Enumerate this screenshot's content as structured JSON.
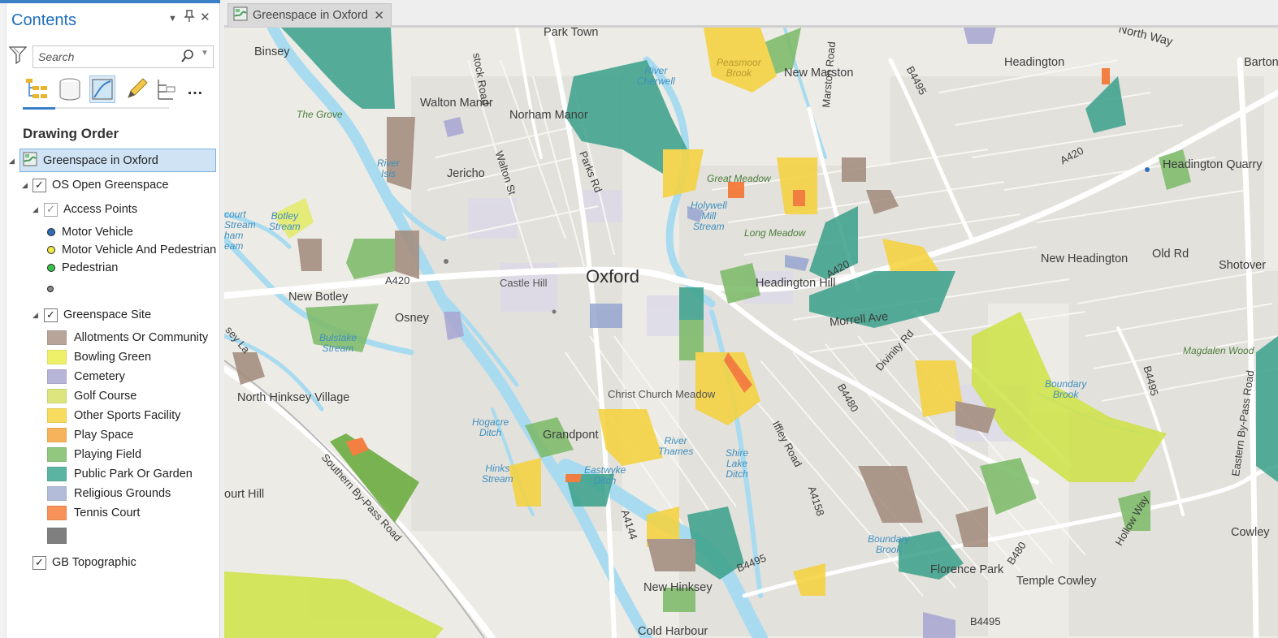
{
  "contents": {
    "title": "Contents",
    "search_placeholder": "Search",
    "section_heading": "Drawing Order",
    "map_name": "Greenspace in Oxford",
    "layers": {
      "open_greenspace": "OS Open Greenspace",
      "access_points": "Access Points",
      "access_items": [
        {
          "label": "Motor Vehicle",
          "color": "#2f6fb8"
        },
        {
          "label": "Motor Vehicle And Pedestrian",
          "color": "#f2e84a"
        },
        {
          "label": "Pedestrian",
          "color": "#36c24a"
        },
        {
          "label": "",
          "color": "#8a8a8a"
        }
      ],
      "greenspace_site": "Greenspace Site",
      "site_items": [
        {
          "label": "Allotments Or Community",
          "color": "#b9a49a"
        },
        {
          "label": "Bowling Green",
          "color": "#eef06a"
        },
        {
          "label": "Cemetery",
          "color": "#b8b6d8"
        },
        {
          "label": "Golf Course",
          "color": "#dde57f"
        },
        {
          "label": "Other Sports Facility",
          "color": "#f8dc5d"
        },
        {
          "label": "Play Space",
          "color": "#f7b35b"
        },
        {
          "label": "Playing Field",
          "color": "#92c77f"
        },
        {
          "label": "Public Park Or Garden",
          "color": "#5bb3a2"
        },
        {
          "label": "Religious Grounds",
          "color": "#b3bcd8"
        },
        {
          "label": "Tennis Court",
          "color": "#f7935a"
        },
        {
          "label": "",
          "color": "#7f7f7f"
        }
      ],
      "basemap": "GB Topographic"
    }
  },
  "map_tab": {
    "label": "Greenspace in Oxford",
    "close": "✕"
  },
  "map_labels": {
    "places": [
      "Park Town",
      "Binsey",
      "Walton Manor",
      "Norham Manor",
      "Jericho",
      "New Marston",
      "Headington",
      "North Way",
      "Barton",
      "Headington Quarry",
      "New Headington",
      "Old Rd",
      "Shotover",
      "Oxford",
      "Headington Hill",
      "Morrell Ave",
      "New Botley",
      "Osney",
      "Castle Hill",
      "North Hinksey Village",
      "Grandpont",
      "Christ Church Meadow",
      "Cowley",
      "Florence Park",
      "Temple Cowley",
      "New Hinksey",
      "Cold Harbour",
      "ourt Hill"
    ],
    "roads": [
      "stock Road",
      "Walton St",
      "Parks Rd",
      "Marston Road",
      "B4495",
      "A420",
      "Divinity Rd",
      "B4480",
      "Iffley Road",
      "A4158",
      "A4144",
      "B480",
      "Hollow Way",
      "Eastern By-Pass Road",
      "Southern By-Pass Road",
      "B4495",
      "B4495",
      "sey La",
      "A420",
      "A420",
      "B4495"
    ],
    "water": [
      "River\nCherwell",
      "River\nIsis",
      "Holywell\nMill\nStream",
      "Botley\nStream",
      "court\nStream\nham\neam",
      "Bulstake\nStream",
      "Hogacre\nDitch",
      "Hinks\nStream",
      "Eastwyke\nDitch",
      "River\nThames",
      "Shire\nLake\nDitch",
      "Boundary\nBrook",
      "Boundary\nBrook",
      "Peasmoor\nBrook"
    ],
    "green": [
      "The Grove",
      "Great Meadow",
      "Long Meadow",
      "Magdalen Wood"
    ]
  }
}
